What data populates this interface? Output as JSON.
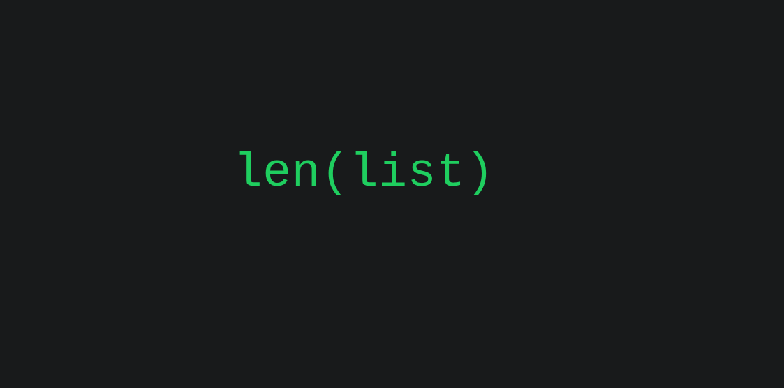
{
  "code": {
    "text": "len(list)"
  },
  "colors": {
    "background": "#181a1b",
    "syntax_green": "#1fce5f"
  }
}
